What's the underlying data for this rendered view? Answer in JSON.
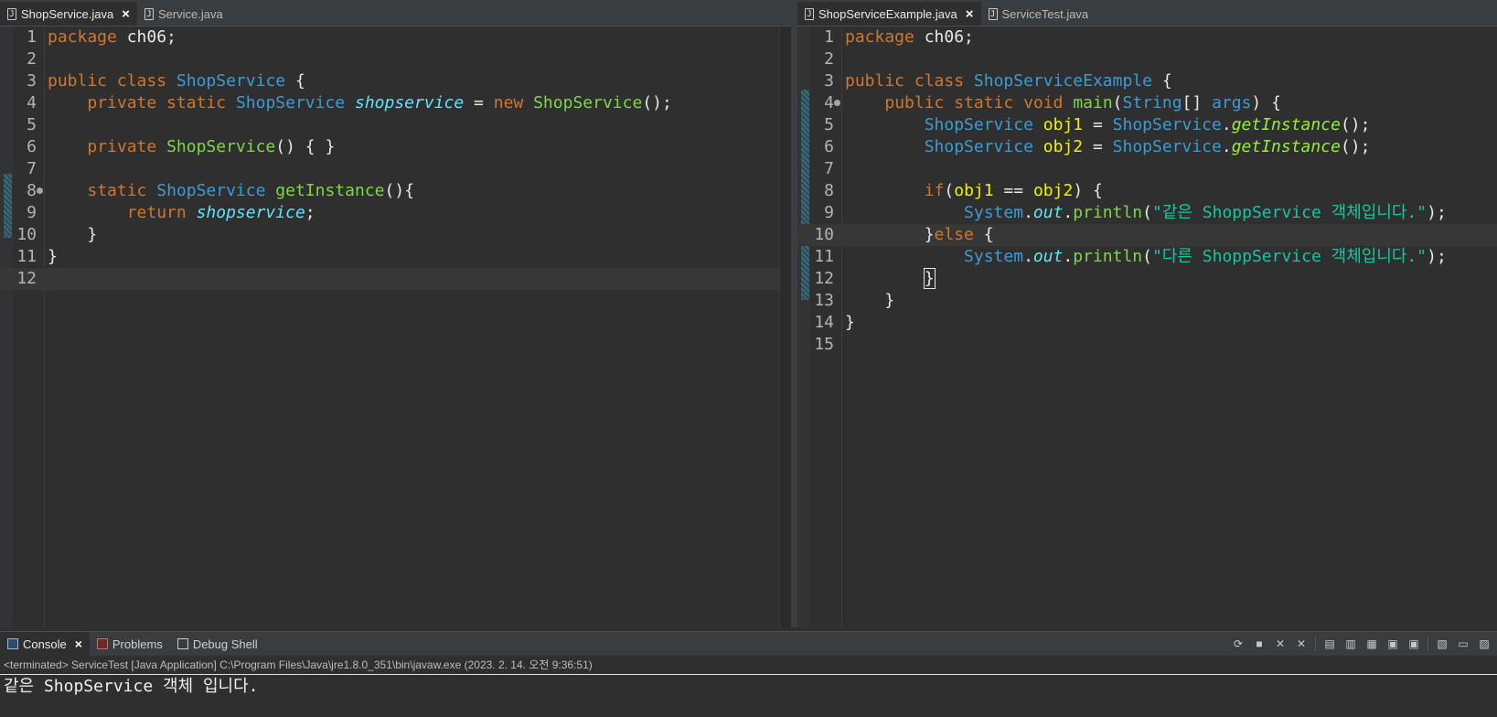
{
  "left_editor": {
    "tabs": [
      {
        "label": "ShopService.java",
        "active": true,
        "closable": true
      },
      {
        "label": "Service.java",
        "active": false,
        "closable": false
      }
    ],
    "lines": [
      {
        "n": "1",
        "tokens": [
          [
            "kw",
            "package"
          ],
          [
            "t",
            " ch06;"
          ]
        ]
      },
      {
        "n": "2",
        "tokens": []
      },
      {
        "n": "3",
        "tokens": [
          [
            "kw",
            "public"
          ],
          [
            "t",
            " "
          ],
          [
            "kw",
            "class"
          ],
          [
            "t",
            " "
          ],
          [
            "cls",
            "ShopService"
          ],
          [
            "t",
            " {"
          ]
        ]
      },
      {
        "n": "4",
        "tokens": [
          [
            "t",
            "    "
          ],
          [
            "kw",
            "private"
          ],
          [
            "t",
            " "
          ],
          [
            "kw",
            "static"
          ],
          [
            "t",
            " "
          ],
          [
            "cls",
            "ShopService"
          ],
          [
            "t",
            " "
          ],
          [
            "fld",
            "shopservice"
          ],
          [
            "t",
            " = "
          ],
          [
            "kw",
            "new"
          ],
          [
            "t",
            " "
          ],
          [
            "mth",
            "ShopService"
          ],
          [
            "t",
            "();"
          ]
        ]
      },
      {
        "n": "5",
        "tokens": []
      },
      {
        "n": "6",
        "tokens": [
          [
            "t",
            "    "
          ],
          [
            "kw",
            "private"
          ],
          [
            "t",
            " "
          ],
          [
            "mth",
            "ShopService"
          ],
          [
            "t",
            "() { }"
          ]
        ]
      },
      {
        "n": "7",
        "tokens": []
      },
      {
        "n": "8",
        "fold": true,
        "tokens": [
          [
            "t",
            "    "
          ],
          [
            "kw",
            "static"
          ],
          [
            "t",
            " "
          ],
          [
            "cls",
            "ShopService"
          ],
          [
            "t",
            " "
          ],
          [
            "mth",
            "getInstance"
          ],
          [
            "t",
            "(){"
          ]
        ]
      },
      {
        "n": "9",
        "tokens": [
          [
            "t",
            "        "
          ],
          [
            "kw",
            "return"
          ],
          [
            "t",
            " "
          ],
          [
            "fld",
            "shopservice"
          ],
          [
            "t",
            ";"
          ]
        ]
      },
      {
        "n": "10",
        "tokens": [
          [
            "t",
            "    }"
          ]
        ]
      },
      {
        "n": "11",
        "tokens": [
          [
            "t",
            "}"
          ]
        ]
      },
      {
        "n": "12",
        "current": true,
        "tokens": []
      }
    ]
  },
  "right_editor": {
    "tabs": [
      {
        "label": "ShopServiceExample.java",
        "active": true,
        "closable": true
      },
      {
        "label": "ServiceTest.java",
        "active": false,
        "closable": false
      }
    ],
    "lines": [
      {
        "n": "1",
        "tokens": [
          [
            "kw",
            "package"
          ],
          [
            "t",
            " ch06;"
          ]
        ]
      },
      {
        "n": "2",
        "tokens": []
      },
      {
        "n": "3",
        "tokens": [
          [
            "kw",
            "public"
          ],
          [
            "t",
            " "
          ],
          [
            "kw",
            "class"
          ],
          [
            "t",
            " "
          ],
          [
            "cls",
            "ShopServiceExample"
          ],
          [
            "t",
            " {"
          ]
        ]
      },
      {
        "n": "4",
        "fold": true,
        "tokens": [
          [
            "t",
            "    "
          ],
          [
            "kw",
            "public"
          ],
          [
            "t",
            " "
          ],
          [
            "kw",
            "static"
          ],
          [
            "t",
            " "
          ],
          [
            "kw",
            "void"
          ],
          [
            "t",
            " "
          ],
          [
            "mth",
            "main"
          ],
          [
            "t",
            "("
          ],
          [
            "cls",
            "String"
          ],
          [
            "t",
            "[] "
          ],
          [
            "cls",
            "args"
          ],
          [
            "t",
            ") {"
          ]
        ]
      },
      {
        "n": "5",
        "tokens": [
          [
            "t",
            "        "
          ],
          [
            "cls",
            "ShopService"
          ],
          [
            "t",
            " "
          ],
          [
            "var",
            "obj1"
          ],
          [
            "t",
            " = "
          ],
          [
            "cls",
            "ShopService"
          ],
          [
            "t",
            "."
          ],
          [
            "smth",
            "getInstance"
          ],
          [
            "t",
            "();"
          ]
        ]
      },
      {
        "n": "6",
        "tokens": [
          [
            "t",
            "        "
          ],
          [
            "cls",
            "ShopService"
          ],
          [
            "t",
            " "
          ],
          [
            "var",
            "obj2"
          ],
          [
            "t",
            " = "
          ],
          [
            "cls",
            "ShopService"
          ],
          [
            "t",
            "."
          ],
          [
            "smth",
            "getInstance"
          ],
          [
            "t",
            "();"
          ]
        ]
      },
      {
        "n": "7",
        "tokens": []
      },
      {
        "n": "8",
        "tokens": [
          [
            "t",
            "        "
          ],
          [
            "kw",
            "if"
          ],
          [
            "t",
            "("
          ],
          [
            "var",
            "obj1"
          ],
          [
            "t",
            " == "
          ],
          [
            "var",
            "obj2"
          ],
          [
            "t",
            ") {"
          ]
        ]
      },
      {
        "n": "9",
        "tokens": [
          [
            "t",
            "            "
          ],
          [
            "cls",
            "System"
          ],
          [
            "t",
            "."
          ],
          [
            "fld",
            "out"
          ],
          [
            "t",
            "."
          ],
          [
            "mth",
            "println"
          ],
          [
            "t",
            "("
          ],
          [
            "str",
            "\"같은 ShoppService 객체입니다.\""
          ],
          [
            "t",
            ");"
          ]
        ]
      },
      {
        "n": "10",
        "current": true,
        "tokens": [
          [
            "t",
            "        }"
          ],
          [
            "kw",
            "else"
          ],
          [
            "t",
            " {"
          ]
        ]
      },
      {
        "n": "11",
        "tokens": [
          [
            "t",
            "            "
          ],
          [
            "cls",
            "System"
          ],
          [
            "t",
            "."
          ],
          [
            "fld",
            "out"
          ],
          [
            "t",
            "."
          ],
          [
            "mth",
            "println"
          ],
          [
            "t",
            "("
          ],
          [
            "str",
            "\"다른 ShoppService 객체입니다.\""
          ],
          [
            "t",
            ");"
          ]
        ]
      },
      {
        "n": "12",
        "tokens": [
          [
            "t",
            "        "
          ],
          [
            "cursor",
            "}"
          ]
        ]
      },
      {
        "n": "13",
        "tokens": [
          [
            "t",
            "    }"
          ]
        ]
      },
      {
        "n": "14",
        "tokens": [
          [
            "t",
            "}"
          ]
        ]
      },
      {
        "n": "15",
        "tokens": []
      }
    ]
  },
  "console": {
    "tabs": [
      {
        "label": "Console",
        "icon": "console-icon",
        "active": true,
        "closable": true
      },
      {
        "label": "Problems",
        "icon": "problems-icon",
        "active": false,
        "closable": false
      },
      {
        "label": "Debug Shell",
        "icon": "debug-icon",
        "active": false,
        "closable": false
      }
    ],
    "header": "<terminated> ServiceTest [Java Application] C:\\Program Files\\Java\\jre1.8.0_351\\bin\\javaw.exe (2023. 2. 14. 오전 9:36:51)",
    "output": "같은 ShopService 객체 입니다."
  },
  "icons": {
    "close": "×",
    "java_file": "J"
  }
}
